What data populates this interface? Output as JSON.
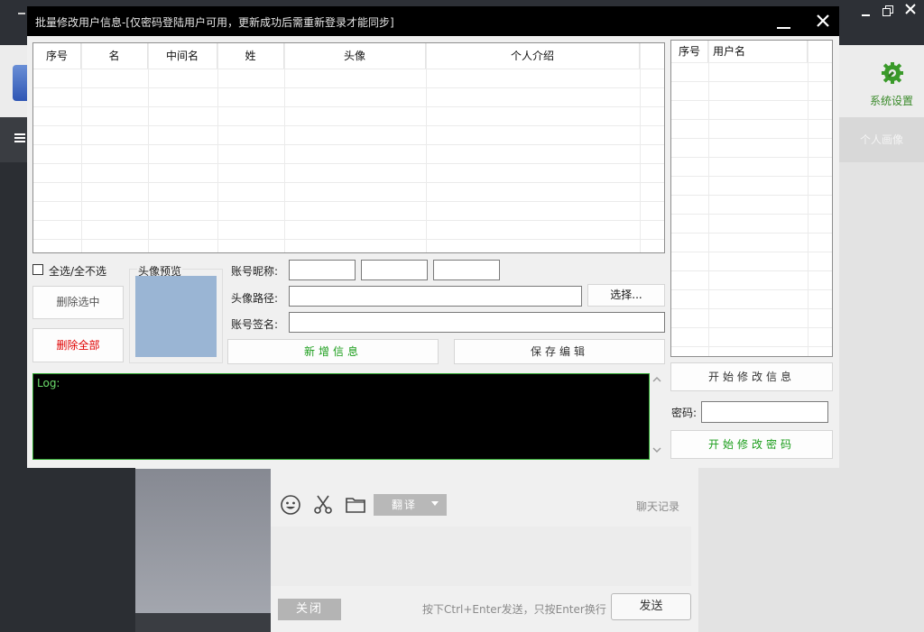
{
  "background_app": {
    "window_controls": {
      "minimize": "▫",
      "close": "✕"
    },
    "header": {
      "settings_label": "系统设置",
      "avatar_tab": "个人画像"
    },
    "chat": {
      "translate_label": "翻译",
      "history_label": "聊天记录",
      "close_label": "关闭",
      "send_hint": "按下Ctrl+Enter发送，只按Enter换行",
      "send_label": "发送"
    }
  },
  "dialog": {
    "title": "批量修改用户信息-[仅密码登陆用户可用，更新成功后需重新登录才能同步]",
    "user_grid": {
      "columns": [
        "序号",
        "名",
        "中间名",
        "姓",
        "头像",
        "个人介绍"
      ]
    },
    "username_grid": {
      "columns": [
        "序号",
        "用户名"
      ]
    },
    "select_all_label": "全选/全不选",
    "delete_selected_label": "删除选中",
    "delete_all_label": "删除全部",
    "avatar_preview_label": "头像预览",
    "nickname_label": "账号昵称:",
    "avatar_path_label": "头像路径:",
    "choose_label": "选择...",
    "signature_label": "账号签名:",
    "add_info_label": "新增信息",
    "save_edit_label": "保存编辑",
    "log_label": "Log:",
    "start_modify_info_label": "开始修改信息",
    "password_label": "密码:",
    "start_modify_password_label": "开始修改密码"
  },
  "colors": {
    "accent_green": "#1a9d1a",
    "danger_red": "#e00000",
    "avatar_preview": "#9ab5d4",
    "log_text": "#6bdc6b"
  }
}
